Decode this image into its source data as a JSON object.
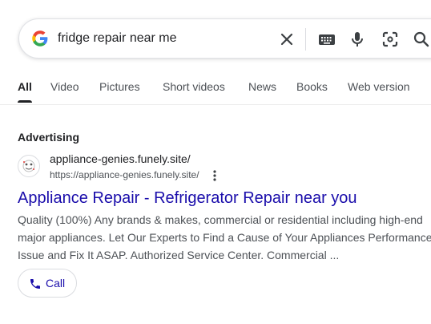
{
  "search": {
    "query": "fridge repair near me"
  },
  "icons": {
    "logo": "google-g-icon",
    "clear": "close-icon",
    "keyboard": "keyboard-icon",
    "voice": "mic-icon",
    "lens": "lens-camera-icon",
    "search": "search-icon",
    "favicon": "site-favicon-icon",
    "more": "more-vert-icon",
    "call": "phone-icon"
  },
  "tabs": [
    {
      "label": "All",
      "active": true
    },
    {
      "label": "Video"
    },
    {
      "label": "Pictures"
    },
    {
      "label": "Short videos"
    },
    {
      "label": "News"
    },
    {
      "label": "Books"
    },
    {
      "label": "Web version"
    }
  ],
  "ad": {
    "label": "Advertising",
    "site_name": "appliance-genies.funely.site/",
    "url": "https://appliance-genies.funely.site/",
    "title": "Appliance Repair - Refrigerator Repair near you",
    "description": "Quality (100%) Any brands & makes, commercial or residential including high-end major appliances. Let Our Experts to Find a Cause of Your Appliances Performance Issue and Fix It ASAP. Authorized Service Center. Commercial ...",
    "call_label": "Call"
  },
  "colors": {
    "link": "#1a0dab",
    "text": "#202124",
    "secondary": "#4d5156",
    "google_blue": "#4285f4",
    "google_red": "#ea4335",
    "google_yellow": "#fbbc05",
    "google_green": "#34a853"
  }
}
